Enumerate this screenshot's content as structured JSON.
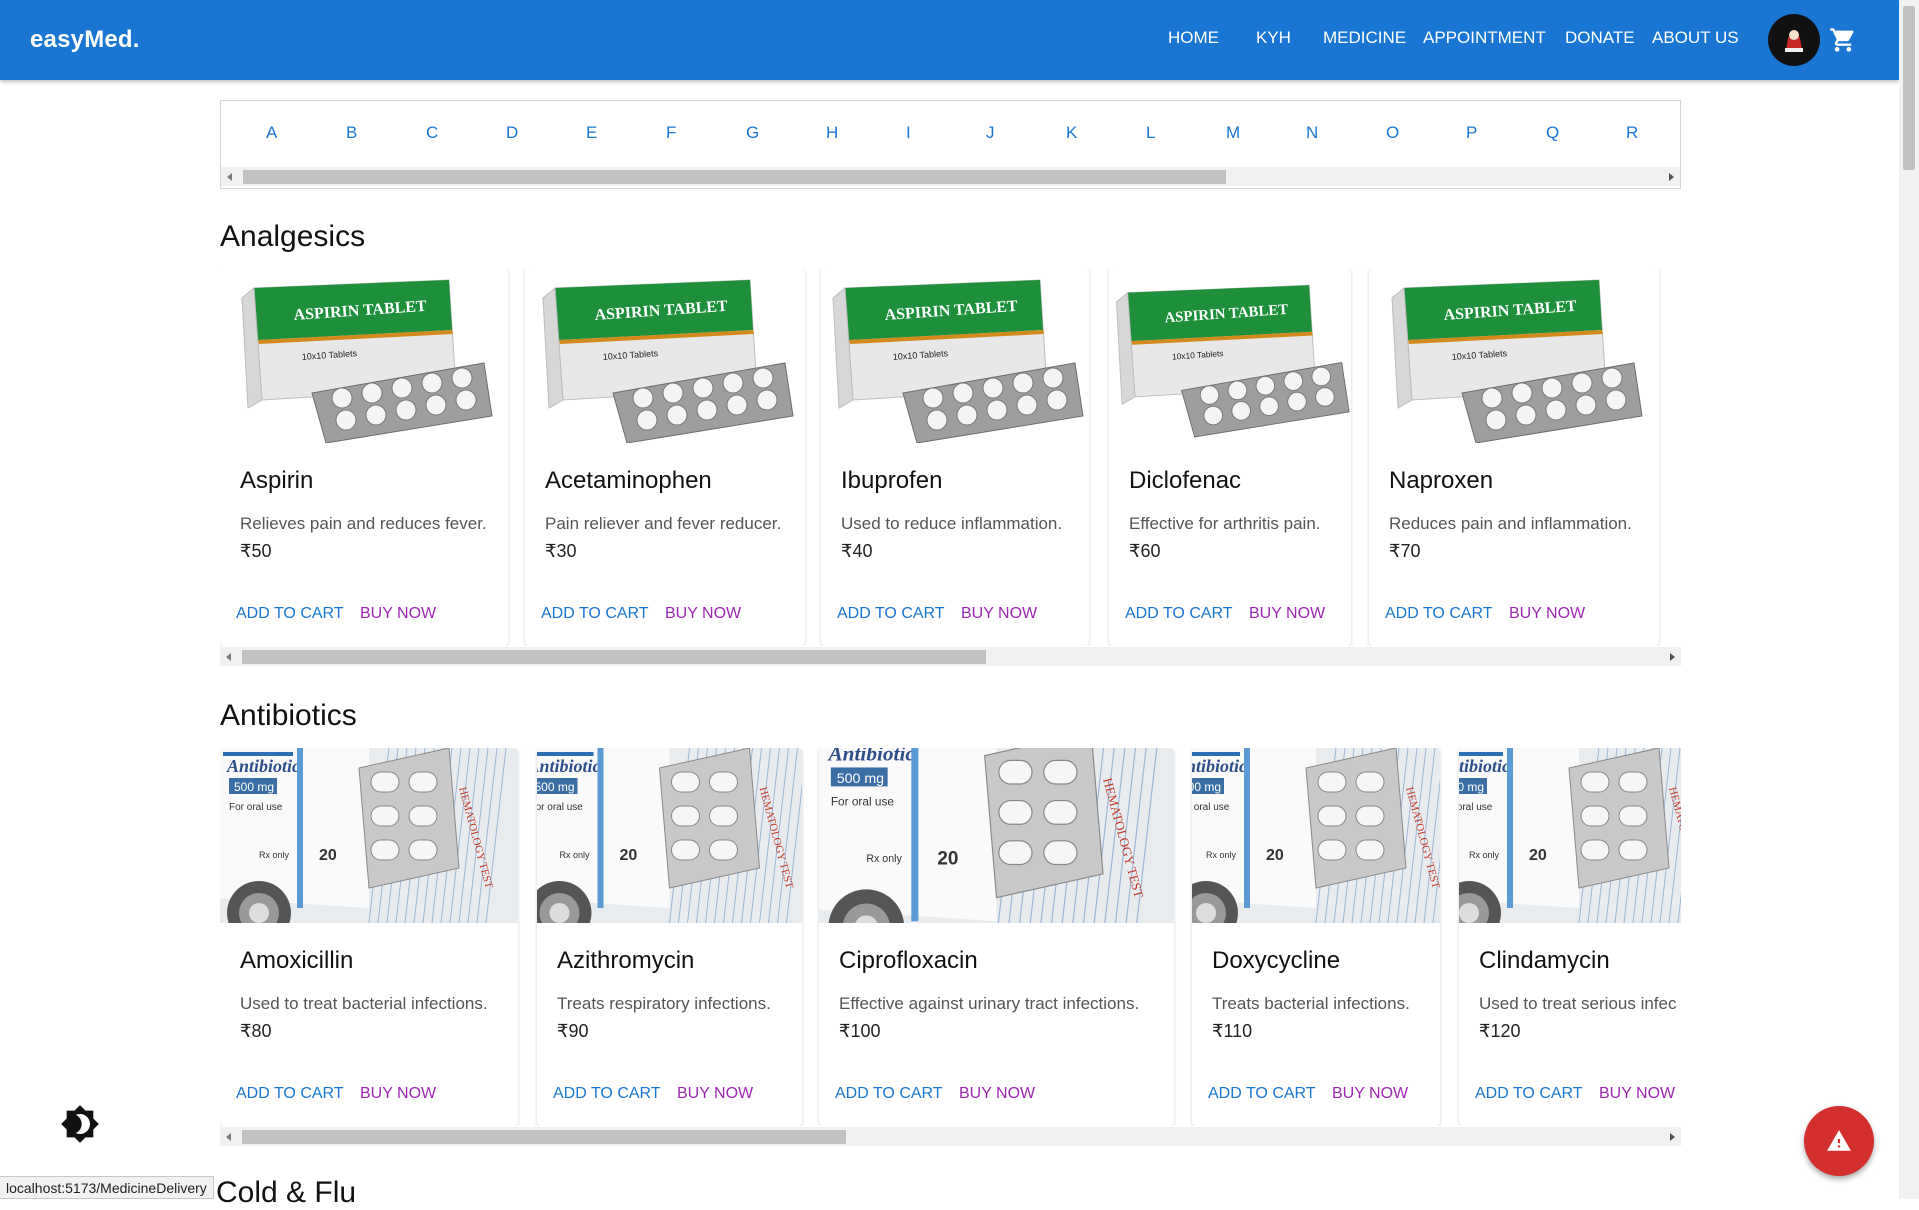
{
  "app": {
    "brand": "easyMed."
  },
  "nav": {
    "items": [
      "HOME",
      "KYH",
      "MEDICINE",
      "APPOINTMENT",
      "DONATE",
      "ABOUT US"
    ]
  },
  "alphabet": [
    "A",
    "B",
    "C",
    "D",
    "E",
    "F",
    "G",
    "H",
    "I",
    "J",
    "K",
    "L",
    "M",
    "N",
    "O",
    "P",
    "Q",
    "R"
  ],
  "sections": [
    {
      "title": "Analgesics",
      "image_kind": "aspirin-box",
      "products": [
        {
          "name": "Aspirin",
          "desc": "Relieves pain and reduces fever.",
          "price": "₹50",
          "add_label": "ADD TO CART",
          "buy_label": "BUY NOW",
          "image_text": "ASPIRIN TABLET"
        },
        {
          "name": "Acetaminophen",
          "desc": "Pain reliever and fever reducer.",
          "price": "₹30",
          "add_label": "ADD TO CART",
          "buy_label": "BUY NOW",
          "image_text": "ASPIRIN TABLET"
        },
        {
          "name": "Ibuprofen",
          "desc": "Used to reduce inflammation.",
          "price": "₹40",
          "add_label": "ADD TO CART",
          "buy_label": "BUY NOW",
          "image_text": "ASPIRIN TABLET"
        },
        {
          "name": "Diclofenac",
          "desc": "Effective for arthritis pain.",
          "price": "₹60",
          "add_label": "ADD TO CART",
          "buy_label": "BUY NOW",
          "image_text": "ASPIRIN TABLET"
        },
        {
          "name": "Naproxen",
          "desc": "Reduces pain and inflammation.",
          "price": "₹70",
          "add_label": "ADD TO CART",
          "buy_label": "BUY NOW",
          "image_text": "ASPIRIN TABLET"
        }
      ]
    },
    {
      "title": "Antibiotics",
      "image_kind": "antibiotic-box",
      "products": [
        {
          "name": "Amoxicillin",
          "desc": "Used to treat bacterial infections.",
          "price": "₹80",
          "add_label": "ADD TO CART",
          "buy_label": "BUY NOW",
          "image_text": "Antibiotic"
        },
        {
          "name": "Azithromycin",
          "desc": "Treats respiratory infections.",
          "price": "₹90",
          "add_label": "ADD TO CART",
          "buy_label": "BUY NOW",
          "image_text": "Antibiotic"
        },
        {
          "name": "Ciprofloxacin",
          "desc": "Effective against urinary tract infections.",
          "price": "₹100",
          "add_label": "ADD TO CART",
          "buy_label": "BUY NOW",
          "image_text": "Antibiotic"
        },
        {
          "name": "Doxycycline",
          "desc": "Treats bacterial infections.",
          "price": "₹110",
          "add_label": "ADD TO CART",
          "buy_label": "BUY NOW",
          "image_text": "Antibiotic"
        },
        {
          "name": "Clindamycin",
          "desc": "Used to treat serious infec",
          "price": "₹120",
          "add_label": "ADD TO CART",
          "buy_label": "BUY NOW",
          "image_text": "Antibiotic"
        }
      ]
    }
  ],
  "next_section_title": "Cold & Flu",
  "status_url": "localhost:5173/MedicineDelivery",
  "colors": {
    "appbar": "#1976d2",
    "primary": "#1976d2",
    "secondary": "#9c27b0",
    "fab": "#d32f2f"
  },
  "icons": {
    "cart": "shopping-cart-icon",
    "theme": "dark-mode-icon",
    "fab": "warning-icon",
    "avatar": "user-avatar"
  }
}
